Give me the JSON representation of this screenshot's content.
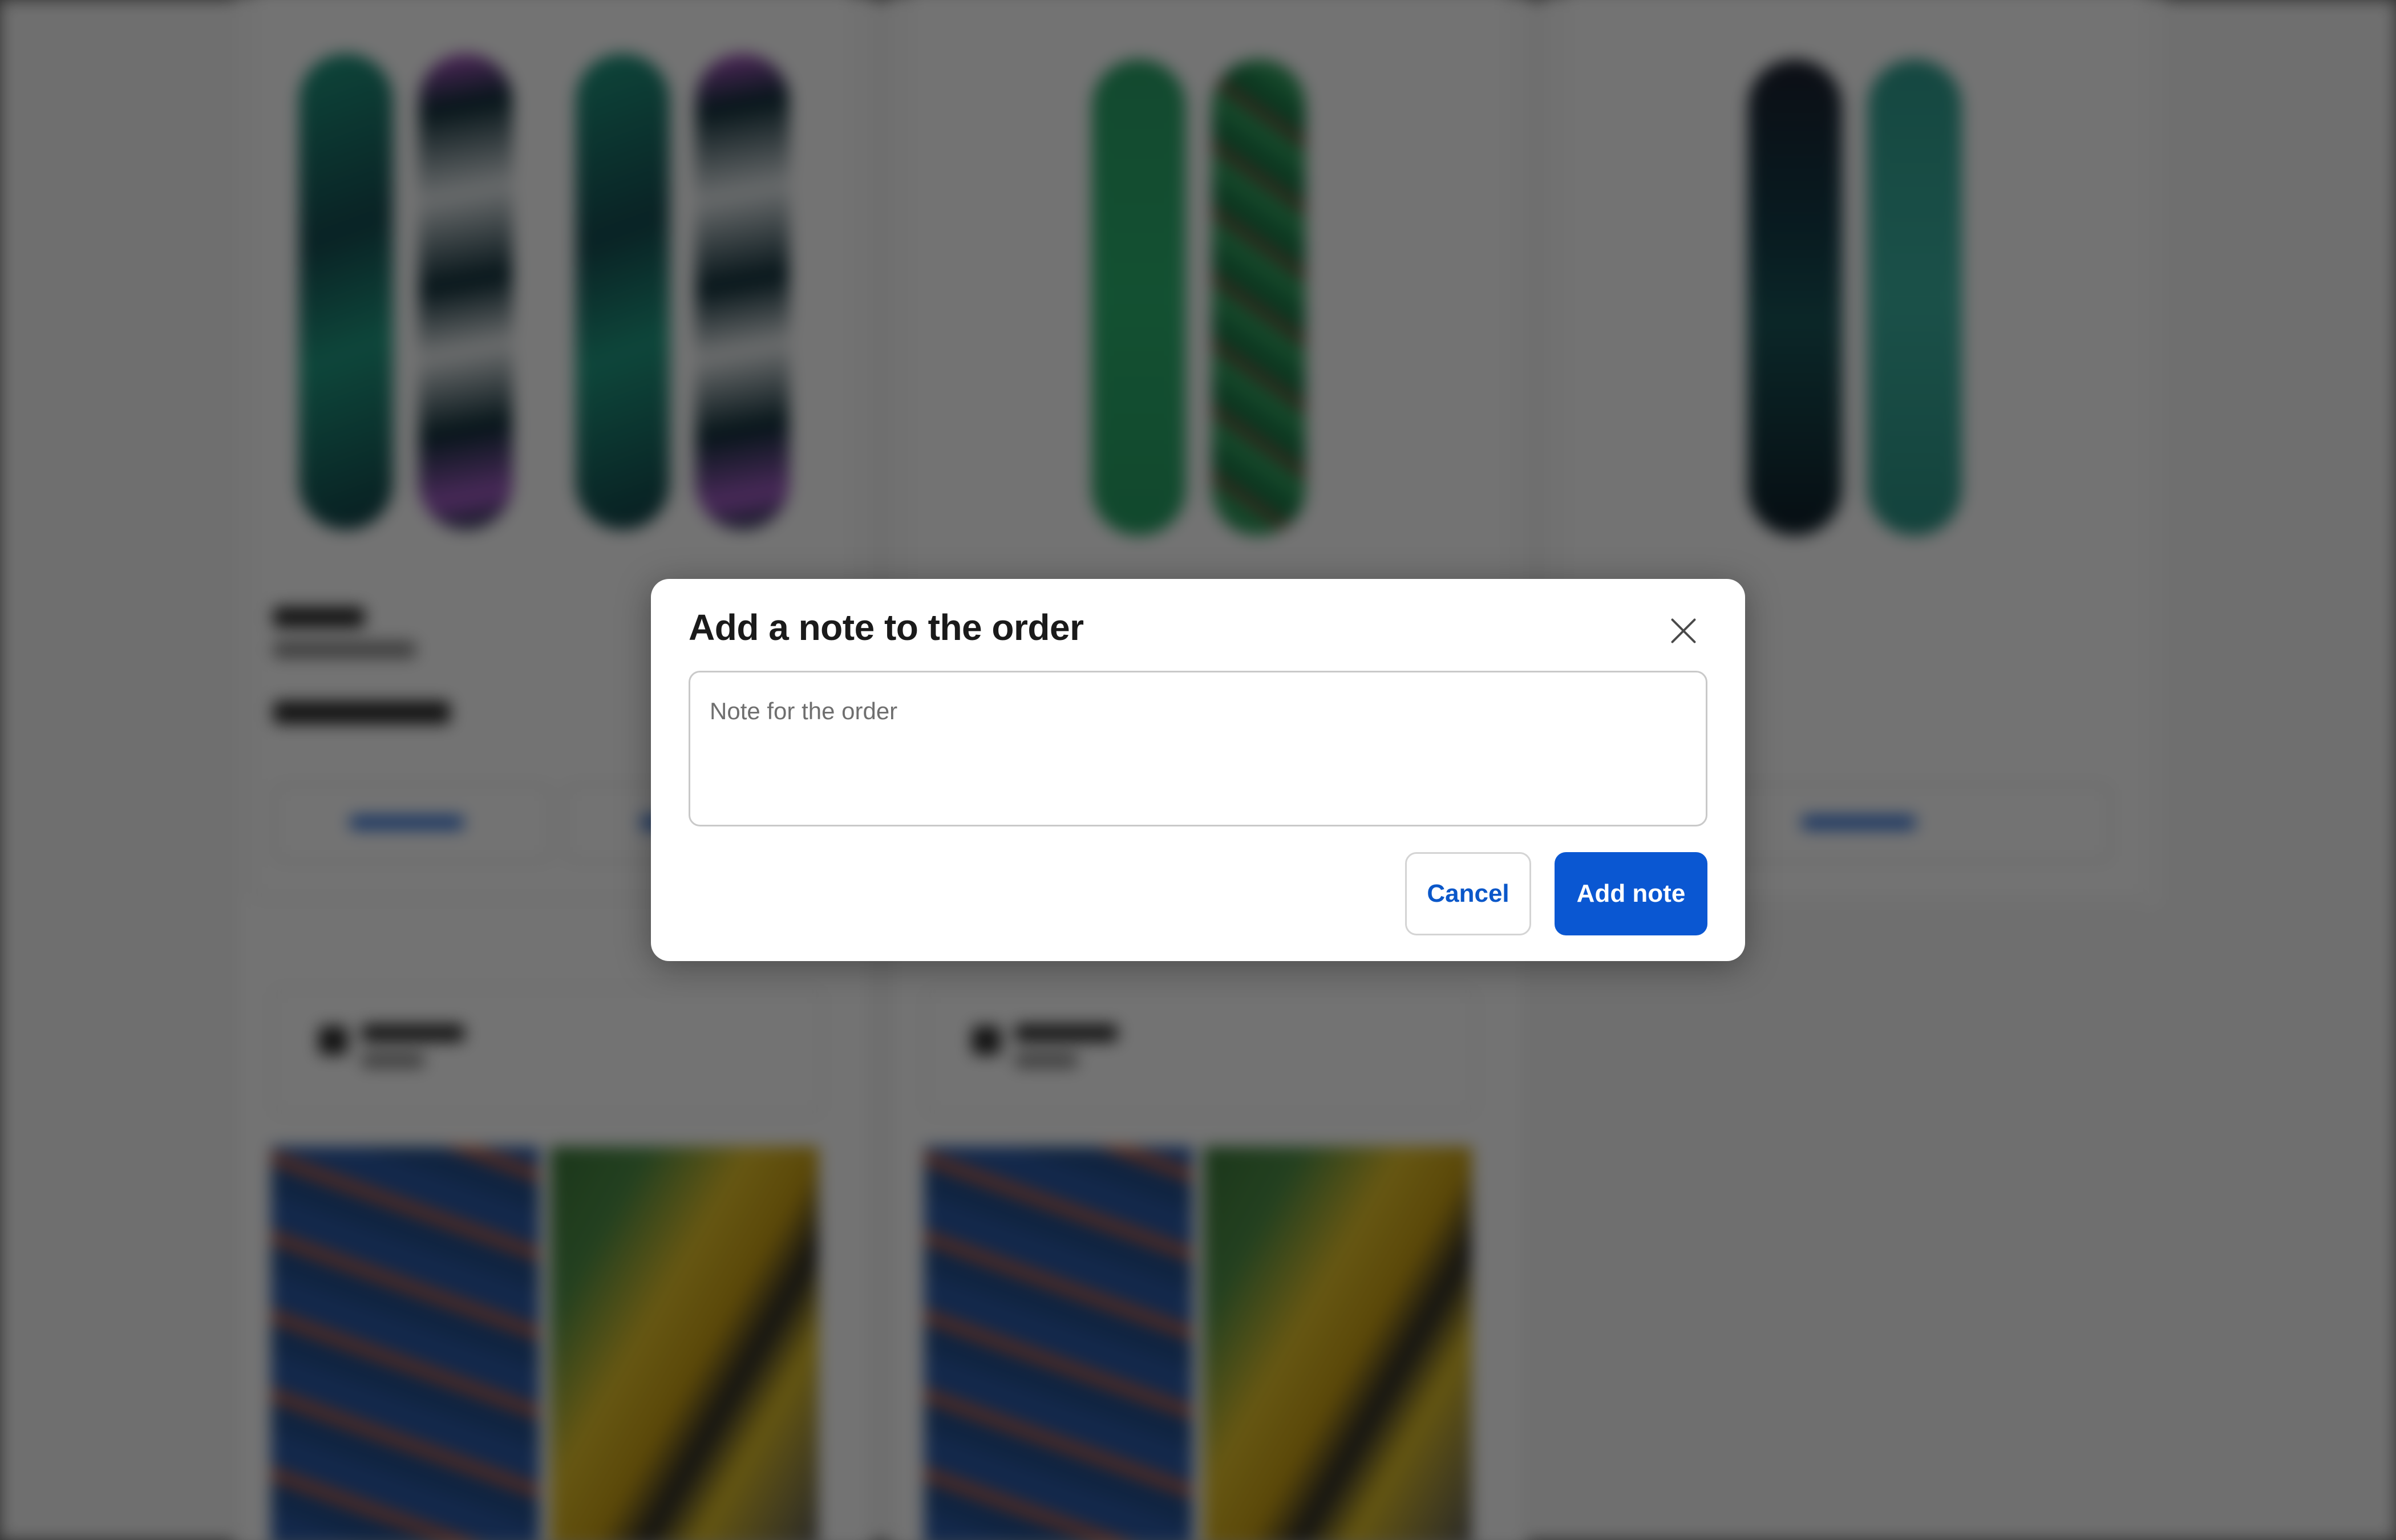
{
  "modal": {
    "title": "Add a note to the order",
    "note_placeholder": "Note for the order",
    "note_value": "",
    "cancel_label": "Cancel",
    "submit_label": "Add note",
    "close_icon": "close-icon"
  },
  "colors": {
    "primary": "#0a57d2",
    "link": "#0a57c9",
    "overlay": "rgba(0,0,0,0.55)"
  }
}
